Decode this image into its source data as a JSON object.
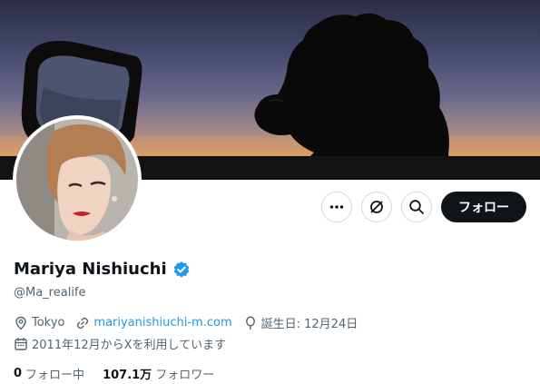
{
  "profile": {
    "display_name": "Mariya Nishiuchi",
    "handle": "@Ma_realife",
    "verified_icon": "verified-badge-icon",
    "location": "Tokyo",
    "website": "mariyanishiuchi-m.com",
    "birthday": "誕生日: 12月24日",
    "joined": "2011年12月からXを利用しています"
  },
  "actions": {
    "more_icon": "more-icon",
    "grok_icon": "grok-icon",
    "search_icon": "search-icon",
    "follow_label": "フォロー"
  },
  "stats": {
    "following_count": "0",
    "following_label": "フォロー中",
    "followers_count": "107.1万",
    "followers_label": "フォロワー"
  },
  "colors": {
    "accent": "#1d9bf0",
    "text_primary": "#0f1419",
    "text_secondary": "#536471",
    "button_dark": "#0f1419"
  }
}
